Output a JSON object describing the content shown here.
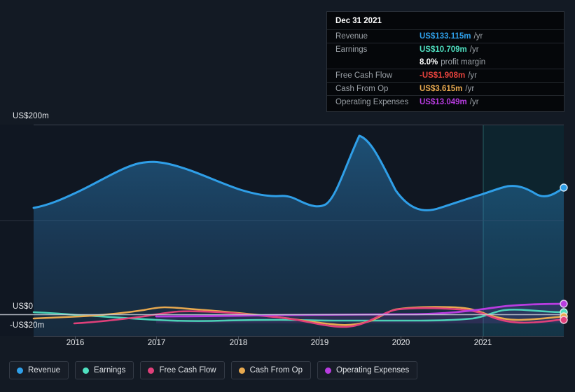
{
  "colors": {
    "background": "#131a24",
    "plot_background": "#101722",
    "forecast_background": "#0c2029",
    "revenue": "#2f9fe8",
    "earnings": "#4fe0c0",
    "free_cash_flow": "#e0407a",
    "cash_from_op": "#e8a94f",
    "operating_expenses": "#b83ce0",
    "zero_line": "#c9ced6",
    "gridline": "#2c3440",
    "axis_text": "#e8eaed"
  },
  "tooltip": {
    "title": "Dec 31 2021",
    "rows": [
      {
        "key": "Revenue",
        "value": "US$133.115m",
        "unit": "/yr",
        "color": "#2f9fe8"
      },
      {
        "key": "Earnings",
        "value": "US$10.709m",
        "unit": "/yr",
        "color": "#4fe0c0"
      },
      {
        "key": "",
        "value": "8.0%",
        "unit": "profit margin",
        "color": "#ffffff"
      },
      {
        "key": "Free Cash Flow",
        "value": "-US$1.908m",
        "unit": "/yr",
        "color": "#e8433d"
      },
      {
        "key": "Cash From Op",
        "value": "US$3.615m",
        "unit": "/yr",
        "color": "#e8a94f"
      },
      {
        "key": "Operating Expenses",
        "value": "US$13.049m",
        "unit": "/yr",
        "color": "#b83ce0"
      }
    ]
  },
  "legend": {
    "items": [
      {
        "label": "Revenue",
        "color": "#2f9fe8"
      },
      {
        "label": "Earnings",
        "color": "#4fe0c0"
      },
      {
        "label": "Free Cash Flow",
        "color": "#e0407a"
      },
      {
        "label": "Cash From Op",
        "color": "#e8a94f"
      },
      {
        "label": "Operating Expenses",
        "color": "#b83ce0"
      }
    ]
  },
  "axes": {
    "y_top_label": "US$200m",
    "y_zero_label": "US$0",
    "y_bottom_label": "-US$20m",
    "x_labels": [
      "2016",
      "2017",
      "2018",
      "2019",
      "2020",
      "2021"
    ]
  },
  "chart_data": {
    "type": "area",
    "title": "",
    "subtitle": "",
    "xlabel": "",
    "ylabel": "",
    "ylim": [
      -20,
      200
    ],
    "yticks": [
      200,
      0,
      -20
    ],
    "ytick_labels": [
      "US$200m",
      "US$0",
      "-US$20m"
    ],
    "grid": true,
    "legend_position": "bottom-left",
    "x": [
      "2015.6",
      "2016",
      "2016.5",
      "2017",
      "2017.5",
      "2018",
      "2018.5",
      "2019",
      "2019.25",
      "2019.5",
      "2019.75",
      "2020",
      "2020.5",
      "2021",
      "2021.5",
      "2021.9"
    ],
    "xtick_labels": [
      "2016",
      "2017",
      "2018",
      "2019",
      "2020",
      "2021"
    ],
    "forecast_region_start": "2021",
    "units": "US$m",
    "series": [
      {
        "name": "Revenue",
        "color": "#2f9fe8",
        "filled": true,
        "values": [
          100,
          111,
          130,
          144,
          136,
          128,
          123,
          128,
          150,
          182,
          172,
          137,
          112,
          122,
          119,
          133
        ]
      },
      {
        "name": "Earnings",
        "color": "#4fe0c0",
        "values": [
          -1,
          -1.5,
          -2,
          -3,
          -4.5,
          -6,
          -6.5,
          -6,
          -6.5,
          -7,
          -7,
          -7,
          -7,
          -4.5,
          -3,
          10.7
        ]
      },
      {
        "name": "Free Cash Flow",
        "color": "#e0407a",
        "values": [
          -6,
          -6,
          -5,
          -4,
          -3.5,
          -4,
          -2,
          -1,
          -4.5,
          -7.5,
          -5,
          -2,
          -2,
          -5.5,
          -7,
          -1.9
        ]
      },
      {
        "name": "Cash From Op",
        "color": "#e8a94f",
        "values": [
          -3,
          -3,
          -2,
          -1,
          0.5,
          1,
          1,
          0.5,
          -3.5,
          -6.5,
          -6,
          2,
          2,
          -2,
          -3,
          3.6
        ]
      },
      {
        "name": "Operating Expenses",
        "color": "#b83ce0",
        "values": [
          null,
          null,
          null,
          -1,
          -1,
          -1,
          -1,
          -1,
          -1,
          -1,
          -1,
          -1,
          -1,
          1.5,
          3,
          13.0
        ]
      }
    ],
    "endpoint_markers": [
      {
        "series": "Revenue",
        "value": 133.115
      },
      {
        "series": "Operating Expenses",
        "value": 13.049
      },
      {
        "series": "Earnings",
        "value": 10.709
      },
      {
        "series": "Cash From Op",
        "value": 3.615
      },
      {
        "series": "Free Cash Flow",
        "value": -1.908
      }
    ]
  }
}
